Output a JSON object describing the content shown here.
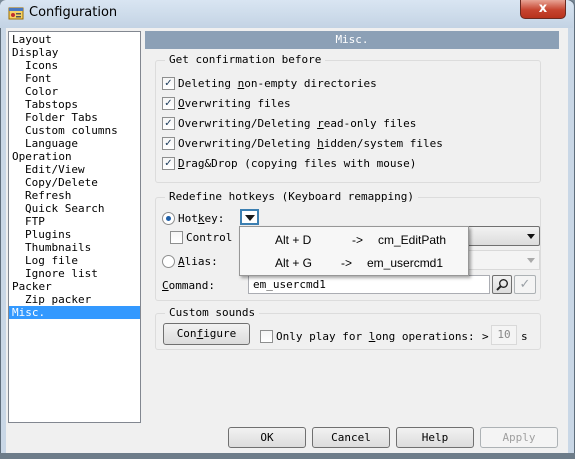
{
  "window": {
    "title": "Configuration",
    "close_label": "x"
  },
  "tree": {
    "items": [
      {
        "label": "Layout",
        "level": 0,
        "selected": false
      },
      {
        "label": "Display",
        "level": 0,
        "selected": false
      },
      {
        "label": "Icons",
        "level": 1,
        "selected": false
      },
      {
        "label": "Font",
        "level": 1,
        "selected": false
      },
      {
        "label": "Color",
        "level": 1,
        "selected": false
      },
      {
        "label": "Tabstops",
        "level": 1,
        "selected": false
      },
      {
        "label": "Folder Tabs",
        "level": 1,
        "selected": false
      },
      {
        "label": "Custom columns",
        "level": 1,
        "selected": false
      },
      {
        "label": "Language",
        "level": 1,
        "selected": false
      },
      {
        "label": "Operation",
        "level": 0,
        "selected": false
      },
      {
        "label": "Edit/View",
        "level": 1,
        "selected": false
      },
      {
        "label": "Copy/Delete",
        "level": 1,
        "selected": false
      },
      {
        "label": "Refresh",
        "level": 1,
        "selected": false
      },
      {
        "label": "Quick Search",
        "level": 1,
        "selected": false
      },
      {
        "label": "FTP",
        "level": 1,
        "selected": false
      },
      {
        "label": "Plugins",
        "level": 1,
        "selected": false
      },
      {
        "label": "Thumbnails",
        "level": 1,
        "selected": false
      },
      {
        "label": "Log file",
        "level": 1,
        "selected": false
      },
      {
        "label": "Ignore list",
        "level": 1,
        "selected": false
      },
      {
        "label": "Packer",
        "level": 0,
        "selected": false
      },
      {
        "label": "Zip packer",
        "level": 1,
        "selected": false
      },
      {
        "label": "Misc.",
        "level": 0,
        "selected": true
      }
    ]
  },
  "panel": {
    "header": "Misc."
  },
  "confirm_group": {
    "title": "Get confirmation before",
    "items": [
      {
        "pre": "Deleting ",
        "hot": "n",
        "post": "on-empty directories",
        "checked": true
      },
      {
        "pre": "",
        "hot": "O",
        "post": "verwriting files",
        "checked": true
      },
      {
        "pre": "Overwriting/Deleting ",
        "hot": "r",
        "post": "ead-only files",
        "checked": true
      },
      {
        "pre": "Overwriting/Deleting ",
        "hot": "h",
        "post": "idden/system files",
        "checked": true
      },
      {
        "pre": "",
        "hot": "D",
        "post": "rag&Drop (copying files with mouse)",
        "checked": true
      }
    ]
  },
  "hotkeys_group": {
    "title": "Redefine hotkeys (Keyboard remapping)",
    "hotkey_pre": "Hot",
    "hotkey_hot": "k",
    "hotkey_post": "ey:",
    "hotkey_selected": true,
    "control_label": "Control +",
    "control_checked": false,
    "alias_hot": "A",
    "alias_post": "lias:",
    "alias_selected": false,
    "command_hot": "C",
    "command_post": "ommand:",
    "command_value": "em_usercmd1",
    "check_mark": "✓"
  },
  "popup": {
    "rows": [
      {
        "key": "Alt + D",
        "arrow": "->",
        "command": "cm_EditPath"
      },
      {
        "key": "Alt + G",
        "arrow": "->",
        "command": "em_usercmd1"
      }
    ]
  },
  "sounds_group": {
    "title": "Custom sounds",
    "configure_pre": "Con",
    "configure_hot": "f",
    "configure_post": "igure",
    "long_pre": "Only play for ",
    "long_hot": "l",
    "long_post": "ong operations:",
    "long_checked": false,
    "gt": ">",
    "seconds_value": "10",
    "seconds_unit": "s"
  },
  "buttons": {
    "ok": "OK",
    "cancel": "Cancel",
    "help": "Help",
    "apply": "Apply"
  },
  "colors": {
    "selection": "#3399ff",
    "panel_header": "#8ca0b6",
    "close_button": "#c6442f"
  }
}
